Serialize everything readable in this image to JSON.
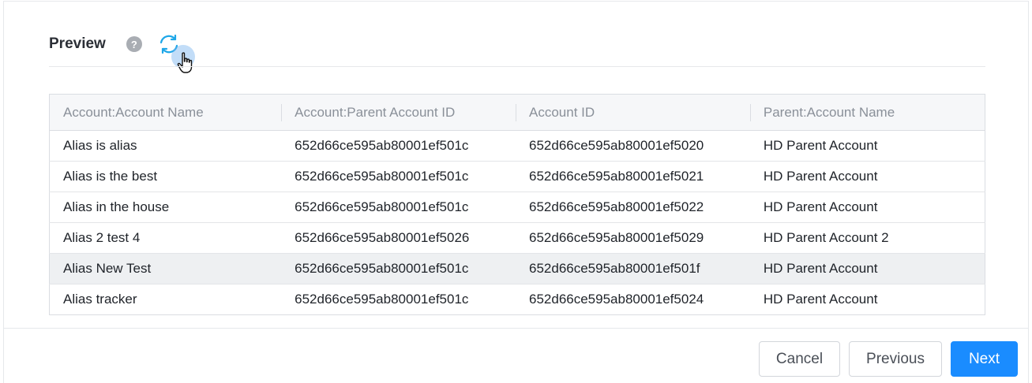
{
  "preview": {
    "title": "Preview",
    "help_icon": "help-circle-icon",
    "help_glyph": "?",
    "refresh_icon": "refresh-icon"
  },
  "table": {
    "columns": [
      "Account:Account Name",
      "Account:Parent Account ID",
      "Account ID",
      "Parent:Account Name"
    ],
    "rows": [
      [
        "Alias is alias",
        "652d66ce595ab80001ef501c",
        "652d66ce595ab80001ef5020",
        "HD Parent Account"
      ],
      [
        "Alias is the best",
        "652d66ce595ab80001ef501c",
        "652d66ce595ab80001ef5021",
        "HD Parent Account"
      ],
      [
        "Alias in the house",
        "652d66ce595ab80001ef501c",
        "652d66ce595ab80001ef5022",
        "HD Parent Account"
      ],
      [
        "Alias 2 test 4",
        "652d66ce595ab80001ef5026",
        "652d66ce595ab80001ef5029",
        "HD Parent Account 2"
      ],
      [
        "Alias New Test",
        "652d66ce595ab80001ef501c",
        "652d66ce595ab80001ef501f",
        "HD Parent Account"
      ],
      [
        "Alias tracker",
        "652d66ce595ab80001ef501c",
        "652d66ce595ab80001ef5024",
        "HD Parent Account"
      ]
    ],
    "highlighted_row": 4
  },
  "footer": {
    "cancel_label": "Cancel",
    "previous_label": "Previous",
    "next_label": "Next"
  },
  "colors": {
    "primary": "#1a8cff",
    "refresh_icon": "#1ea7e8",
    "help_icon": "#a9adb3"
  }
}
